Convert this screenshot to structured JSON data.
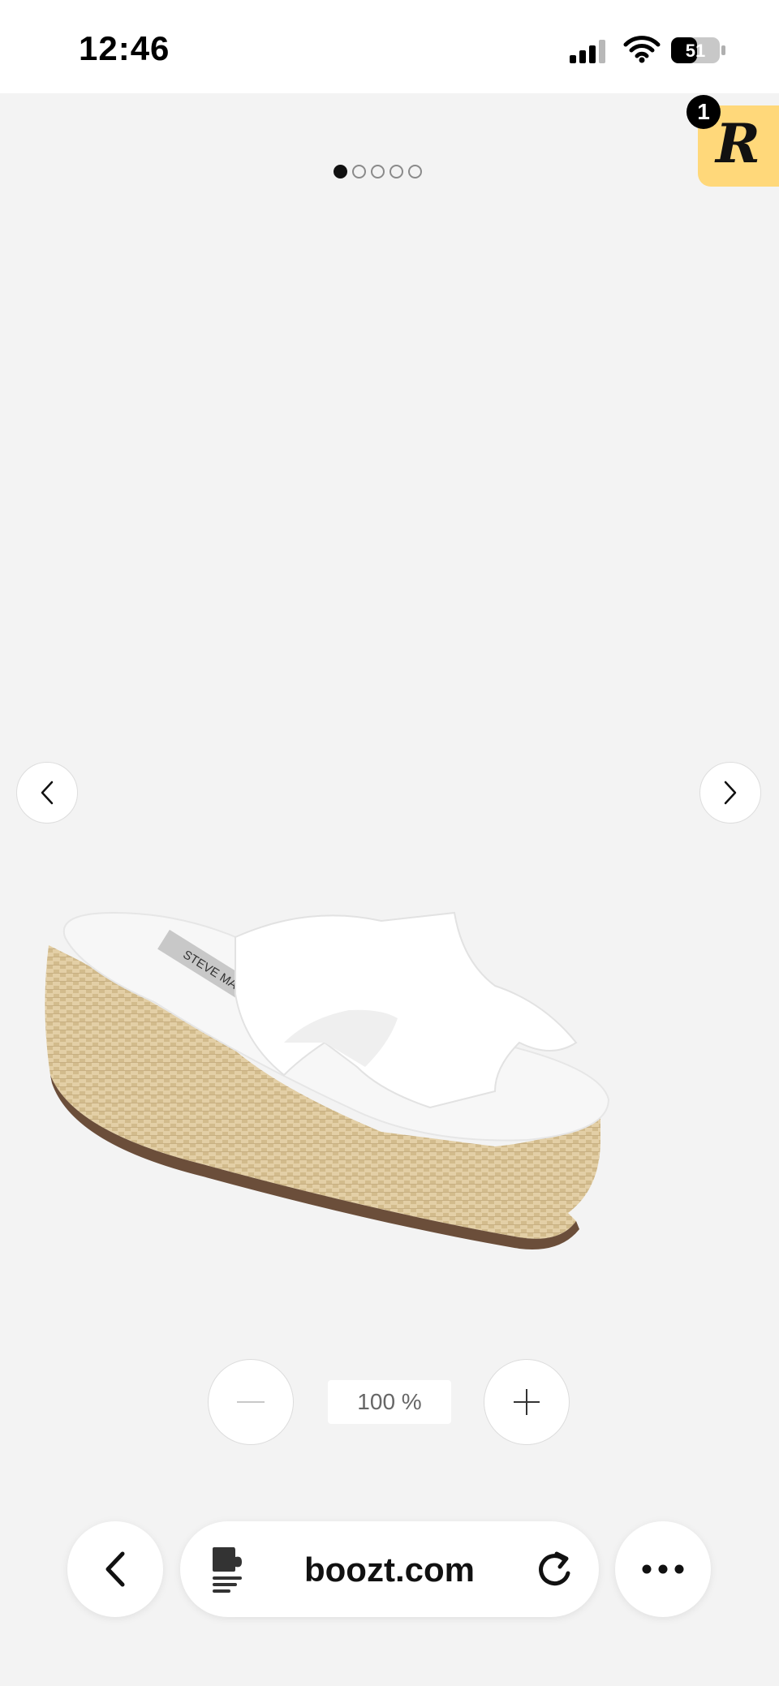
{
  "status_bar": {
    "time": "12:46",
    "battery": "51"
  },
  "gallery": {
    "dots_total": 5,
    "active_dot": 1,
    "extension_badge_count": "1",
    "extension_badge_letter": "R",
    "product_brand_label": "STEVE MADDEN",
    "prev_icon": "chevron-left-icon",
    "next_icon": "chevron-right-icon"
  },
  "zoom": {
    "level": "100 %",
    "zoom_out_icon": "minus-icon",
    "zoom_in_icon": "plus-icon"
  },
  "browser": {
    "url": "boozt.com",
    "back_icon": "chevron-left-icon",
    "page_icon": "page-settings-icon",
    "reload_icon": "reload-icon",
    "more_icon": "ellipsis-icon"
  },
  "colors": {
    "background": "#f3f3f3",
    "extension_badge": "#ffd87a"
  }
}
